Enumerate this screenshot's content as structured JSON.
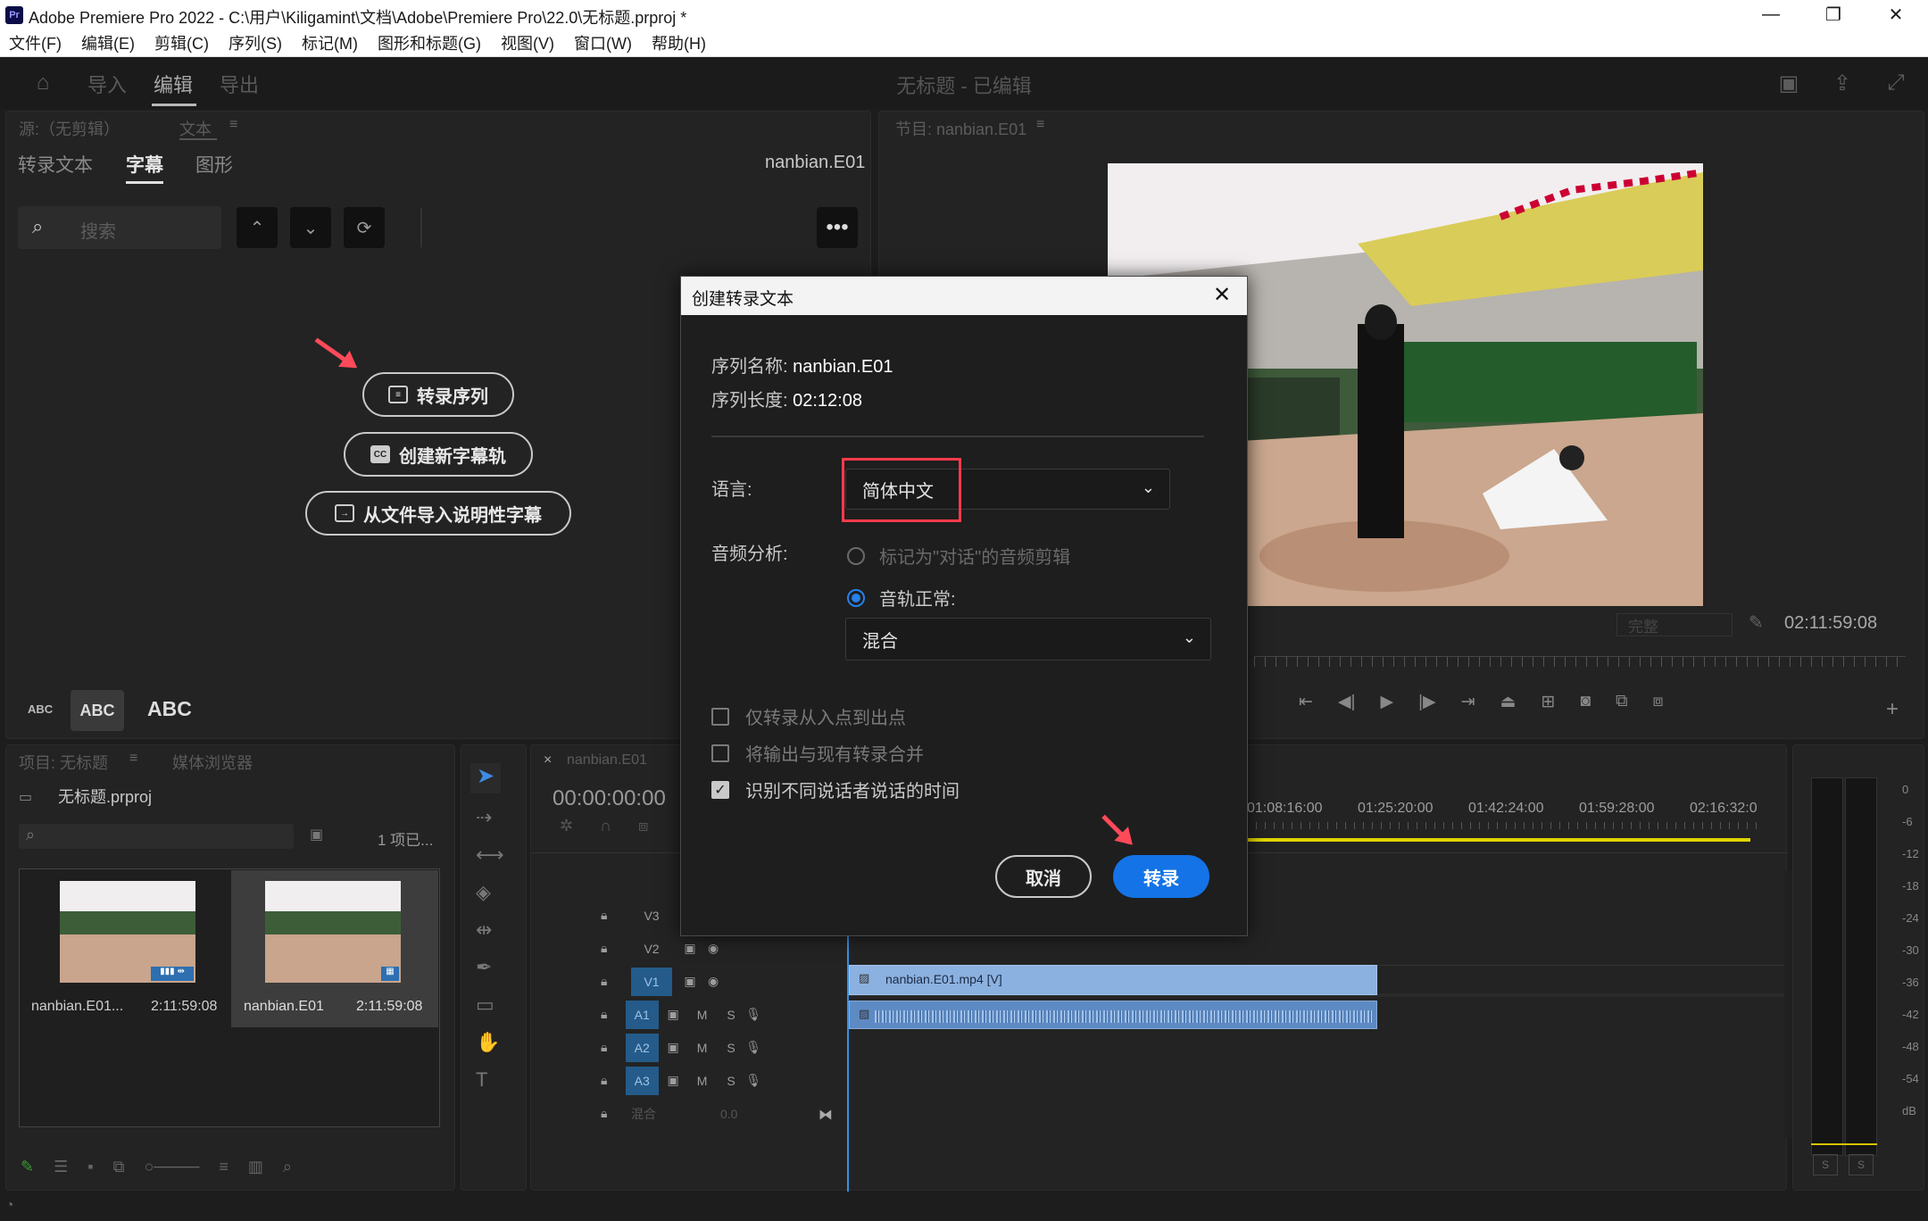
{
  "window": {
    "logo": "Pr",
    "title": "Adobe Premiere Pro 2022 - C:\\用户\\Kiligamint\\文档\\Adobe\\Premiere Pro\\22.0\\无标题.prproj *",
    "minimize": "—",
    "maximize": "❐",
    "close": "✕"
  },
  "menu": [
    "文件(F)",
    "编辑(E)",
    "剪辑(C)",
    "序列(S)",
    "标记(M)",
    "图形和标题(G)",
    "视图(V)",
    "窗口(W)",
    "帮助(H)"
  ],
  "header": {
    "tabs": [
      "导入",
      "编辑",
      "导出"
    ],
    "active_tab": "编辑",
    "document_title": "无标题 - 已编辑"
  },
  "source_panel": {
    "tab_source": "源:（无剪辑）",
    "tab_text": "文本",
    "subtabs": [
      "转录文本",
      "字幕",
      "图形"
    ],
    "active_subtab": "字幕",
    "sequence_name": "nanbian.E01",
    "search_placeholder": "搜索",
    "buttons": {
      "transcribe_sequence": "转录序列",
      "new_caption_track": "创建新字幕轨",
      "import_captions": "从文件导入说明性字幕"
    },
    "cc_icon": "CC",
    "text_sizes": [
      "ABC",
      "ABC",
      "ABC"
    ]
  },
  "program_panel": {
    "title": "节目: nanbian.E01",
    "fit_label": "完整",
    "timecode": "02:11:59:08"
  },
  "project_panel": {
    "tab_project": "项目: 无标题",
    "tab_media": "媒体浏览器",
    "project_file": "无标题.prproj",
    "item_count": "1 项已...",
    "items": [
      {
        "name": "nanbian.E01...",
        "duration": "2:11:59:08"
      },
      {
        "name": "nanbian.E01",
        "duration": "2:11:59:08"
      }
    ]
  },
  "timeline": {
    "tab": "nanbian.E01",
    "timecode": "00:00:00:00",
    "ruler": [
      "01:08:16:00",
      "01:25:20:00",
      "01:42:24:00",
      "01:59:28:00",
      "02:16:32:0"
    ],
    "tracks": [
      "V3",
      "V2",
      "V1",
      "A1",
      "A2",
      "A3"
    ],
    "mix_label": "混合",
    "mix_value": "0.0",
    "video_clip": "nanbian.E01.mp4 [V]",
    "mute": "M",
    "solo": "S"
  },
  "meters": {
    "scale": [
      "0",
      "-6",
      "-12",
      "-18",
      "-24",
      "-30",
      "-36",
      "-42",
      "-48",
      "-54",
      "dB"
    ],
    "solo_left": "S",
    "solo_right": "S"
  },
  "dialog": {
    "title": "创建转录文本",
    "seq_name_label": "序列名称:",
    "seq_name_value": "nanbian.E01",
    "seq_len_label": "序列长度:",
    "seq_len_value": "02:12:08",
    "language_label": "语言:",
    "language_value": "简体中文",
    "audio_label": "音频分析:",
    "radio_dialogue": "标记为\"对话\"的音频剪辑",
    "radio_track": "音轨正常:",
    "track_value": "混合",
    "check_inout": "仅转录从入点到出点",
    "check_merge": "将输出与现有转录合并",
    "check_speakers": "识别不同说话者说话的时间",
    "cancel": "取消",
    "transcribe": "转录"
  }
}
